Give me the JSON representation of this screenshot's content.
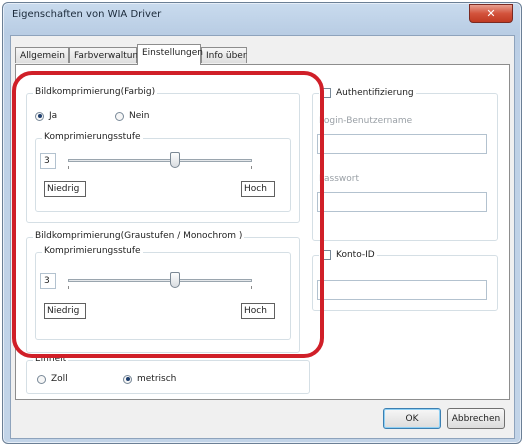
{
  "window": {
    "title": "Eigenschaften von WIA Driver",
    "close_glyph": "✕"
  },
  "tabs": [
    {
      "label": "Allgemein",
      "active": false
    },
    {
      "label": "Farbverwaltung",
      "active": false
    },
    {
      "label": "Einstellungen",
      "active": true
    },
    {
      "label": "Info über",
      "active": false
    }
  ],
  "color_compression": {
    "label": "Bildkomprimierung(Farbig)",
    "options": [
      {
        "label": "Ja",
        "selected": true
      },
      {
        "label": "Nein",
        "selected": false
      }
    ],
    "level": {
      "label": "Komprimierungsstufe",
      "value": "3",
      "slider_fraction": 0.58,
      "low_label": "Niedrig",
      "high_label": "Hoch"
    }
  },
  "gray_compression": {
    "label": "Bildkomprimierung(Graustufen / Monochrom )",
    "level": {
      "label": "Komprimierungsstufe",
      "value": "3",
      "slider_fraction": 0.58,
      "low_label": "Niedrig",
      "high_label": "Hoch"
    }
  },
  "units": {
    "label": "Einheit",
    "options": [
      {
        "label": "Zoll",
        "selected": false
      },
      {
        "label": "metrisch",
        "selected": true
      }
    ]
  },
  "auth": {
    "checkbox_label": "Authentifizierung",
    "checked": false,
    "login_label": "Login-Benutzername",
    "login_value": "",
    "password_label": "Passwort",
    "password_value": ""
  },
  "account": {
    "checkbox_label": "Konto-ID",
    "checked": false,
    "value": ""
  },
  "buttons": {
    "ok": "OK",
    "cancel": "Abbrechen"
  },
  "colors": {
    "highlight": "#d01f28",
    "close_button": "#c03a22",
    "title_bar": "#bdd0e6"
  }
}
